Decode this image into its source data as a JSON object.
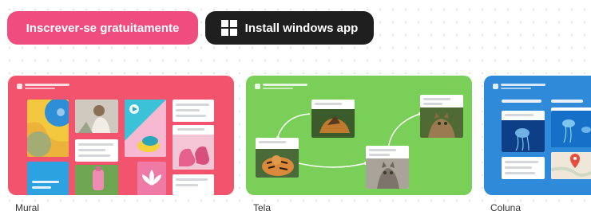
{
  "buttons": {
    "signup_label": "Inscrever-se gratuitamente",
    "install_label": "Install windows app"
  },
  "icons": {
    "install": "windows-logo-icon",
    "map_pin": "location-pin-icon",
    "image_badge": "image-icon"
  },
  "boards": [
    {
      "label": "Mural",
      "color": "#f2546e"
    },
    {
      "label": "Tela",
      "color": "#7acf59"
    },
    {
      "label": "Coluna",
      "color": "#2f8ad9"
    }
  ],
  "colors": {
    "signup_bg": "#ef4c80",
    "install_bg": "#1f1f1f"
  }
}
